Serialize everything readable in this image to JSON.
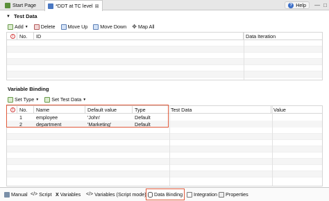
{
  "tabs": [
    {
      "label": "Start Page",
      "active": false
    },
    {
      "label": "*DDT at TC level",
      "active": true,
      "close": "⊠"
    }
  ],
  "help": {
    "label": "Help"
  },
  "test_data": {
    "title": "Test Data",
    "toolbar": {
      "add": "Add",
      "delete": "Delete",
      "move_up": "Move Up",
      "move_down": "Move Down",
      "map_all": "Map All"
    },
    "columns": [
      "No.",
      "ID",
      "Data Iteration"
    ]
  },
  "variable_binding": {
    "title": "Variable Binding",
    "toolbar": {
      "set_type": "Set Type",
      "set_test_data": "Set Test Data"
    },
    "columns": [
      "No.",
      "Name",
      "Default value",
      "Type",
      "Test Data",
      "Value"
    ],
    "rows": [
      {
        "no": "1",
        "name": "employee",
        "default": "'John'",
        "type": "Default"
      },
      {
        "no": "2",
        "name": "department",
        "default": "'Marketing'",
        "type": "Default"
      }
    ]
  },
  "bottom_tabs": [
    {
      "label": "Manual",
      "icon": "manual-icon"
    },
    {
      "label": "Script",
      "icon": "script-icon"
    },
    {
      "label": "Variables",
      "icon": "variables-icon"
    },
    {
      "label": "Variables (Script mode)",
      "icon": "script-mode-icon"
    },
    {
      "label": "Data Binding",
      "icon": "database-icon",
      "active": true
    },
    {
      "label": "Integration",
      "icon": "integration-icon"
    },
    {
      "label": "Properties",
      "icon": "properties-icon"
    }
  ],
  "colors": {
    "highlight": "#e05a3a",
    "accent": "#3b6ec7"
  }
}
